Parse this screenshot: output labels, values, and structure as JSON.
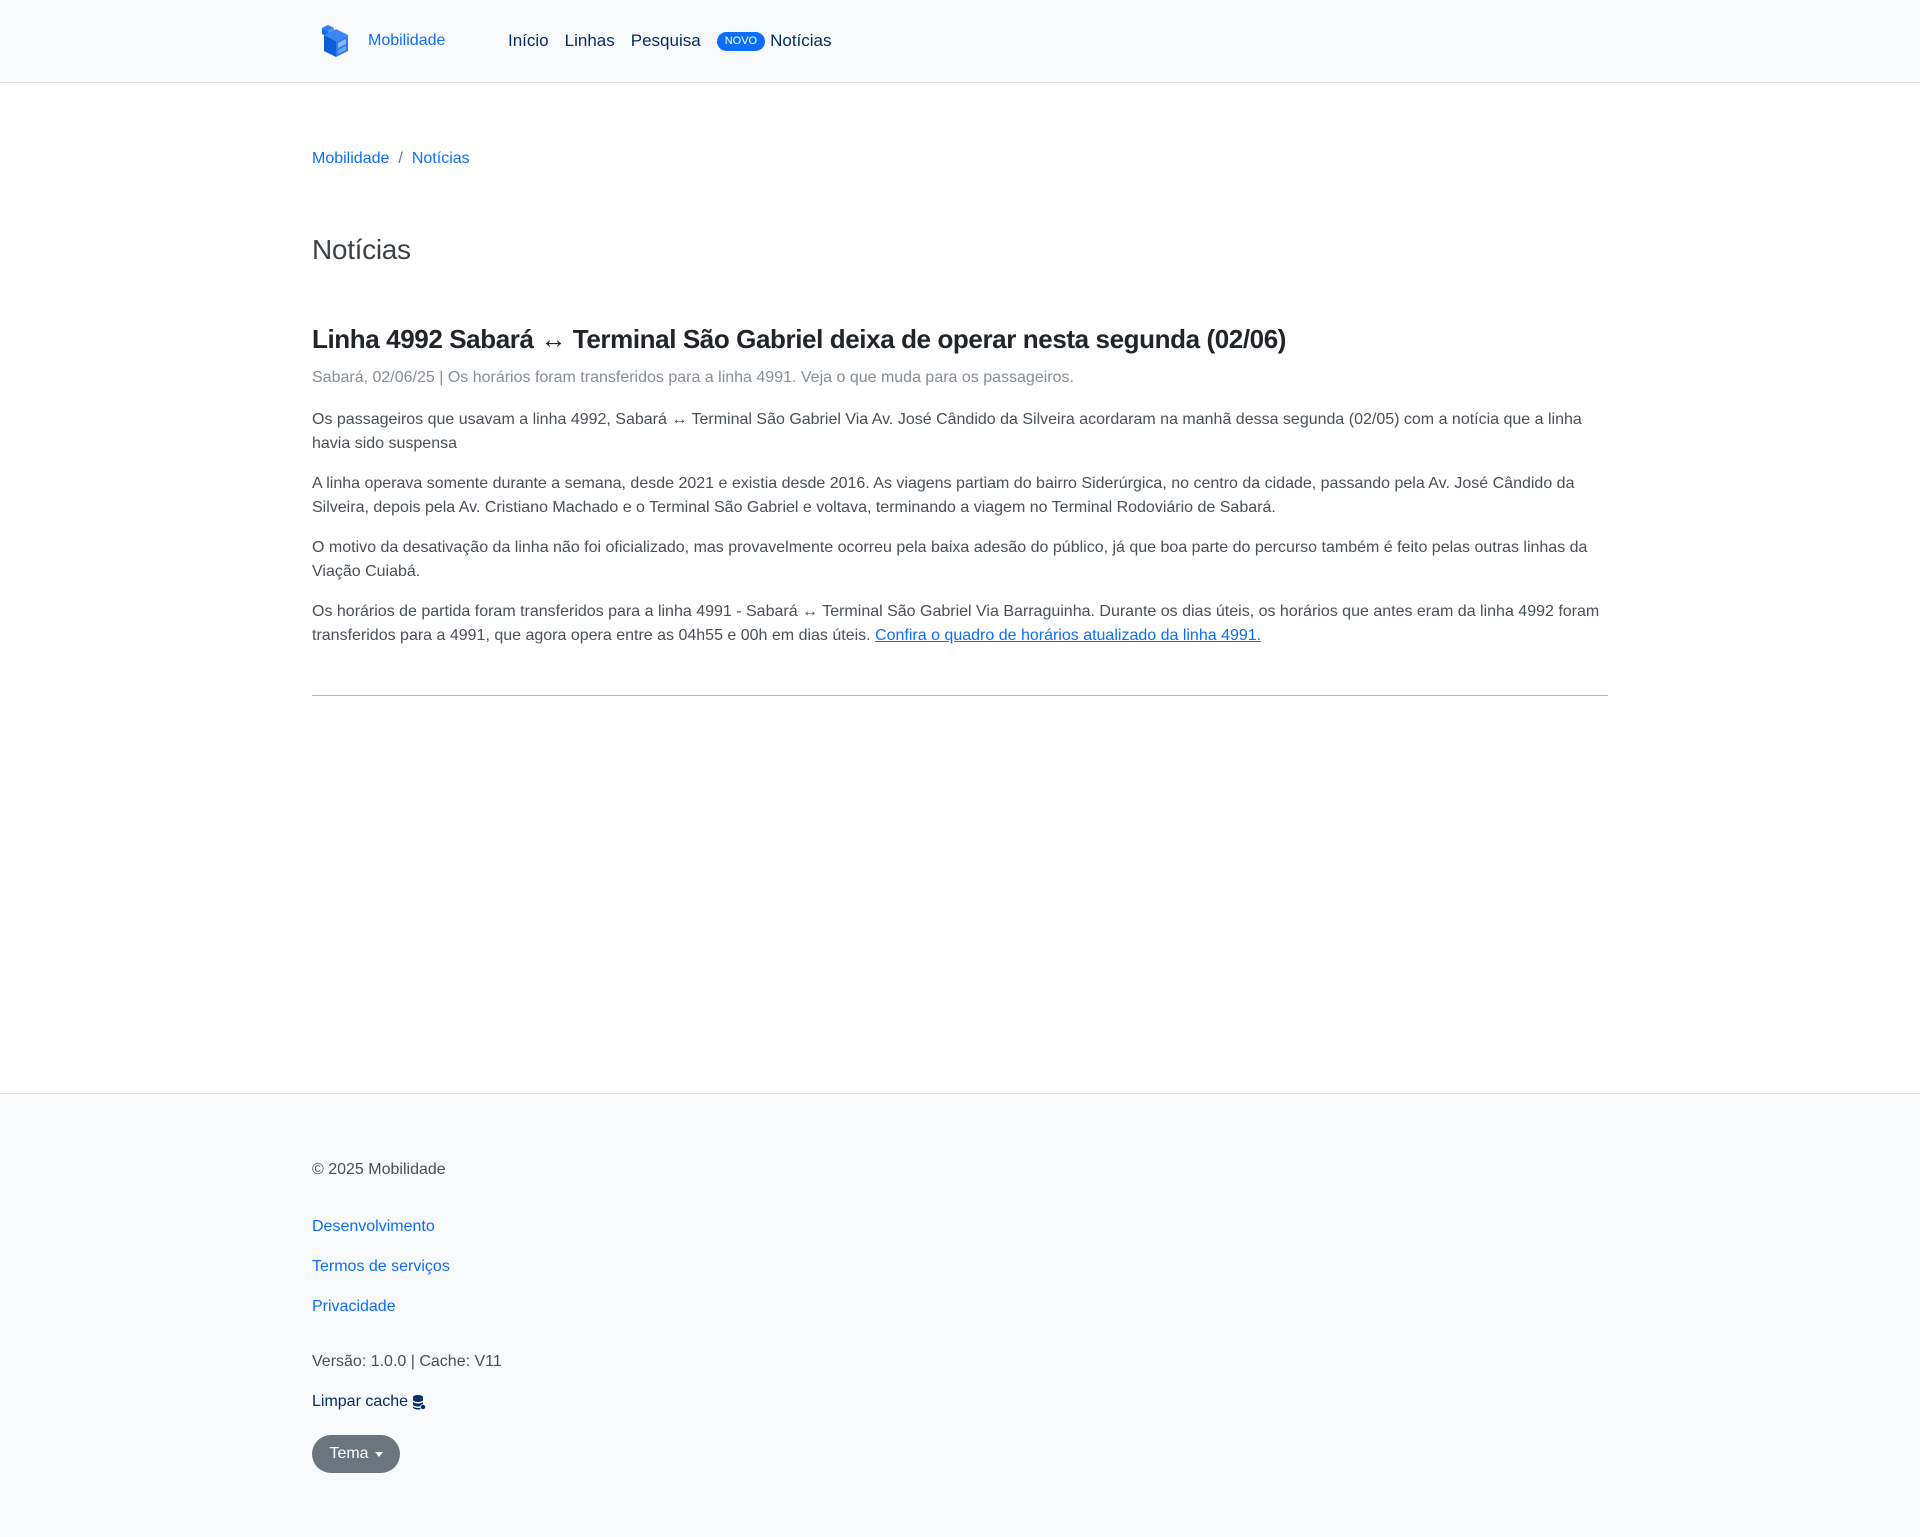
{
  "header": {
    "brand": "Mobilidade",
    "nav": {
      "inicio": "Início",
      "linhas": "Linhas",
      "pesquisa": "Pesquisa",
      "badge": "NOVO",
      "noticias": "Notícias"
    }
  },
  "breadcrumb": {
    "home": "Mobilidade",
    "separator": "/",
    "current": "Notícias"
  },
  "page": {
    "title": "Notícias"
  },
  "article": {
    "title": "Linha 4992 Sabará ↔ Terminal São Gabriel deixa de operar nesta segunda (02/06)",
    "meta": "Sabará, 02/06/25 | Os horários foram transferidos para a linha 4991. Veja o que muda para os passageiros.",
    "paragraphs": [
      "Os passageiros que usavam a linha 4992, Sabará ↔ Terminal São Gabriel Via Av. José Cândido da Silveira acordaram na manhã dessa segunda (02/05) com a notícia que a linha havia sido suspensa",
      "A linha operava somente durante a semana, desde 2021 e existia desde 2016. As viagens partiam do bairro Siderúrgica, no centro da cidade, passando pela Av. José Cândido da Silveira, depois pela Av. Cristiano Machado e o Terminal São Gabriel e voltava, terminando a viagem no Terminal Rodoviário de Sabará.",
      "O motivo da desativação da linha não foi oficializado, mas provavelmente ocorreu pela baixa adesão do público, já que boa parte do percurso também é feito pelas outras linhas da Viação Cuiabá.",
      "Os horários de partida foram transferidos para a linha 4991 - Sabará ↔ Terminal São Gabriel Via Barraguinha. Durante os dias úteis, os horários que antes eram da linha 4992 foram transferidos para a 4991, que agora opera entre as 04h55 e 00h em dias úteis."
    ],
    "link_text": "Confira o quadro de horários atualizado da linha 4991."
  },
  "footer": {
    "copyright": "© 2025 Mobilidade",
    "links": {
      "dev": "Desenvolvimento",
      "terms": "Termos de serviços",
      "privacy": "Privacidade"
    },
    "version": "Versão: 1.0.0 | Cache: V11",
    "clear_cache": "Limpar cache",
    "clear_cache_icon": "database-icon",
    "theme": "Tema"
  },
  "colors": {
    "primary": "#0d6efd",
    "nav_text": "#052c65",
    "muted": "#868e96",
    "secondary_button": "#6c757d"
  }
}
